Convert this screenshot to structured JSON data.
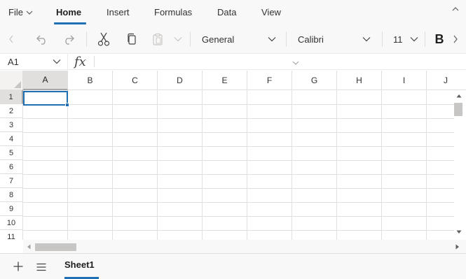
{
  "menu": {
    "items": [
      {
        "label": "File"
      },
      {
        "label": "Home"
      },
      {
        "label": "Insert"
      },
      {
        "label": "Formulas"
      },
      {
        "label": "Data"
      },
      {
        "label": "View"
      }
    ],
    "active": "Home"
  },
  "toolbar": {
    "number_format": "General",
    "font_name": "Calibri",
    "font_size": "11",
    "bold_label": "B",
    "icons": [
      "chevron-left-icon",
      "undo-icon",
      "redo-icon",
      "cut-icon",
      "copy-icon",
      "paste-icon",
      "chevron-down-icon",
      "chevron-right-icon"
    ]
  },
  "formula_bar": {
    "name_box": "A1",
    "fx_label": "fx",
    "formula_value": ""
  },
  "grid": {
    "columns": [
      "A",
      "B",
      "C",
      "D",
      "E",
      "F",
      "G",
      "H",
      "I",
      "J"
    ],
    "rows": [
      "1",
      "2",
      "3",
      "4",
      "5",
      "6",
      "7",
      "8",
      "9",
      "10",
      "11"
    ],
    "active_cell": "A1"
  },
  "sheets": {
    "tabs": [
      {
        "label": "Sheet1"
      }
    ],
    "active": "Sheet1"
  },
  "colors": {
    "accent": "#1f6fb5",
    "header_bg": "#f8f8f8",
    "gridline": "#e1dfdd",
    "selected_header": "#e1dfdd"
  }
}
